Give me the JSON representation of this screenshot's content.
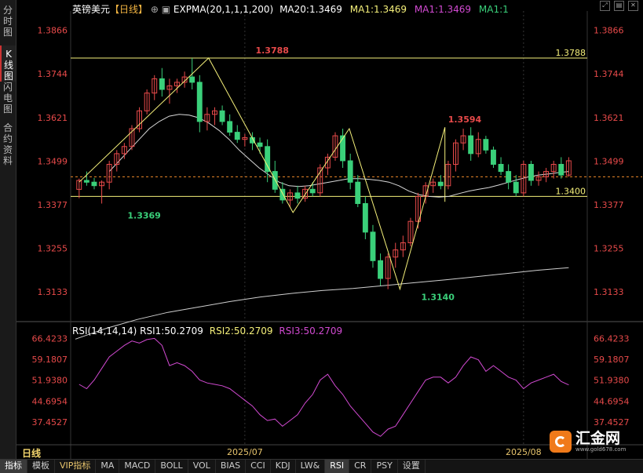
{
  "sidebar": {
    "tabs": [
      {
        "label": "分时图",
        "active": false
      },
      {
        "label": "K线图",
        "active": true
      },
      {
        "label": "闪电图",
        "active": false
      },
      {
        "label": "合约资料",
        "active": false
      }
    ]
  },
  "header": {
    "symbol": "英镑美元",
    "period_tag": "【日线】",
    "indicator": "EXPMA(20,1,1,1,200)",
    "ma20": "MA20:1.3469",
    "ma1a": "MA1:1.3469",
    "ma1b": "MA1:1.3469",
    "ma1c": "MA1:1"
  },
  "rsi_header": {
    "name": "RSI(14,14,14)",
    "rsi1": "RSI1:50.2709",
    "rsi2": "RSI2:50.2709",
    "rsi3": "RSI3:50.2709"
  },
  "period_label": "日线",
  "bottom_tabs": [
    {
      "label": "指标",
      "active": true
    },
    {
      "label": "模板"
    },
    {
      "label": "VIP指标",
      "vip": true
    },
    {
      "label": "MA"
    },
    {
      "label": "MACD"
    },
    {
      "label": "BOLL"
    },
    {
      "label": "VOL"
    },
    {
      "label": "BIAS"
    },
    {
      "label": "CCI"
    },
    {
      "label": "KDJ"
    },
    {
      "label": "LW&"
    },
    {
      "label": "RSI",
      "active": true
    },
    {
      "label": "CR"
    },
    {
      "label": "PSY"
    },
    {
      "label": "设置"
    }
  ],
  "logo": {
    "name": "汇金网",
    "url": "www.gold678.com"
  },
  "colors": {
    "up": "#e84a4a",
    "down": "#3ad07a",
    "grid_text": "#e84a4a",
    "rsi": "#d24ad2",
    "ma": "#d8d8d8",
    "fib": "#f5f07a"
  },
  "chart_data": [
    {
      "type": "candlestick",
      "symbol": "英镑美元",
      "yticks": [
        "1.3866",
        "1.3744",
        "1.3621",
        "1.3499",
        "1.3377",
        "1.3255",
        "1.3133"
      ],
      "ylim": [
        1.306,
        1.392
      ],
      "xticks": [
        {
          "label": "2025/07",
          "index": 22
        },
        {
          "label": "2025/08",
          "index": 59
        }
      ],
      "hlines": [
        {
          "value": 1.3788,
          "label": "1.3788"
        },
        {
          "value": 1.34,
          "label": "1.3400"
        }
      ],
      "current_price": 1.3455,
      "annotations": [
        {
          "label": "1.3788",
          "index": 23,
          "value": 1.3788,
          "color": "#e84a4a"
        },
        {
          "label": "1.3369",
          "index": 6,
          "value": 1.3369,
          "color": "#3ad07a"
        },
        {
          "label": "1.3140",
          "index": 45,
          "value": 1.314,
          "color": "#3ad07a"
        },
        {
          "label": "1.3594",
          "index": 70,
          "value": 1.3594,
          "color": "#e84a4a"
        }
      ],
      "zigzag": [
        {
          "index": 0,
          "value": 1.344
        },
        {
          "index": 23,
          "value": 1.3788
        },
        {
          "index": 38,
          "value": 1.3355
        },
        {
          "index": 48,
          "value": 1.359
        },
        {
          "index": 57,
          "value": 1.314
        },
        {
          "index": 70,
          "value": 1.3594
        },
        {
          "index": 79,
          "value": 1.3385
        },
        {
          "index": 87,
          "value": 1.353
        }
      ],
      "candles": [
        [
          1.342,
          1.345,
          1.3395,
          1.3445
        ],
        [
          1.3445,
          1.347,
          1.343,
          1.344
        ],
        [
          1.344,
          1.3452,
          1.342,
          1.343
        ],
        [
          1.343,
          1.3445,
          1.338,
          1.344
        ],
        [
          1.344,
          1.35,
          1.342,
          1.349
        ],
        [
          1.349,
          1.353,
          1.347,
          1.352
        ],
        [
          1.352,
          1.355,
          1.3505,
          1.354
        ],
        [
          1.354,
          1.36,
          1.353,
          1.359
        ],
        [
          1.359,
          1.365,
          1.358,
          1.364
        ],
        [
          1.364,
          1.37,
          1.363,
          1.369
        ],
        [
          1.369,
          1.374,
          1.367,
          1.373
        ],
        [
          1.373,
          1.376,
          1.368,
          1.37
        ],
        [
          1.37,
          1.373,
          1.366,
          1.371
        ],
        [
          1.371,
          1.373,
          1.369,
          1.372
        ],
        [
          1.372,
          1.375,
          1.3705,
          1.3735
        ],
        [
          1.3735,
          1.3788,
          1.37,
          1.372
        ],
        [
          1.372,
          1.374,
          1.358,
          1.361
        ],
        [
          1.361,
          1.365,
          1.3585,
          1.363
        ],
        [
          1.363,
          1.365,
          1.36,
          1.364
        ],
        [
          1.364,
          1.3655,
          1.36,
          1.361
        ],
        [
          1.361,
          1.363,
          1.357,
          1.358
        ],
        [
          1.358,
          1.36,
          1.355,
          1.356
        ],
        [
          1.356,
          1.3575,
          1.354,
          1.3565
        ],
        [
          1.3565,
          1.358,
          1.353,
          1.355
        ],
        [
          1.355,
          1.3565,
          1.352,
          1.354
        ],
        [
          1.354,
          1.356,
          1.344,
          1.347
        ],
        [
          1.347,
          1.35,
          1.341,
          1.342
        ],
        [
          1.342,
          1.344,
          1.338,
          1.339
        ],
        [
          1.339,
          1.342,
          1.337,
          1.341
        ],
        [
          1.341,
          1.343,
          1.338,
          1.3395
        ],
        [
          1.3395,
          1.343,
          1.3385,
          1.342
        ],
        [
          1.342,
          1.344,
          1.34,
          1.341
        ],
        [
          1.341,
          1.349,
          1.34,
          1.348
        ],
        [
          1.348,
          1.352,
          1.346,
          1.351
        ],
        [
          1.351,
          1.358,
          1.35,
          1.357
        ],
        [
          1.357,
          1.359,
          1.348,
          1.35
        ],
        [
          1.35,
          1.352,
          1.342,
          1.344
        ],
        [
          1.344,
          1.346,
          1.337,
          1.338
        ],
        [
          1.338,
          1.34,
          1.328,
          1.33
        ],
        [
          1.33,
          1.332,
          1.32,
          1.322
        ],
        [
          1.322,
          1.324,
          1.315,
          1.317
        ],
        [
          1.317,
          1.324,
          1.314,
          1.323
        ],
        [
          1.323,
          1.327,
          1.32,
          1.325
        ],
        [
          1.325,
          1.329,
          1.323,
          1.327
        ],
        [
          1.327,
          1.334,
          1.326,
          1.333
        ],
        [
          1.333,
          1.341,
          1.331,
          1.34
        ],
        [
          1.34,
          1.344,
          1.338,
          1.343
        ],
        [
          1.343,
          1.345,
          1.341,
          1.344
        ],
        [
          1.344,
          1.346,
          1.342,
          1.343
        ],
        [
          1.343,
          1.35,
          1.342,
          1.349
        ],
        [
          1.349,
          1.356,
          1.347,
          1.355
        ],
        [
          1.355,
          1.359,
          1.353,
          1.357
        ],
        [
          1.357,
          1.3594,
          1.35,
          1.352
        ],
        [
          1.352,
          1.358,
          1.351,
          1.356
        ],
        [
          1.356,
          1.357,
          1.352,
          1.353
        ],
        [
          1.353,
          1.354,
          1.348,
          1.349
        ],
        [
          1.349,
          1.351,
          1.346,
          1.347
        ],
        [
          1.347,
          1.349,
          1.342,
          1.344
        ],
        [
          1.344,
          1.346,
          1.34,
          1.341
        ],
        [
          1.341,
          1.35,
          1.34,
          1.349
        ],
        [
          1.349,
          1.35,
          1.343,
          1.3445
        ],
        [
          1.3445,
          1.347,
          1.343,
          1.3455
        ],
        [
          1.3455,
          1.348,
          1.344,
          1.347
        ],
        [
          1.347,
          1.35,
          1.345,
          1.349
        ],
        [
          1.349,
          1.351,
          1.345,
          1.346
        ],
        [
          1.346,
          1.351,
          1.3455,
          1.35
        ]
      ],
      "ma_slow": [
        1.347,
        1.35,
        1.353,
        1.356,
        1.359,
        1.361,
        1.3625,
        1.363,
        1.3628,
        1.362,
        1.3605,
        1.3585,
        1.356,
        1.353,
        1.3505,
        1.348,
        1.346,
        1.344,
        1.343,
        1.3428,
        1.343,
        1.3435,
        1.344,
        1.3445,
        1.345,
        1.345,
        1.3448,
        1.3445,
        1.344,
        1.343,
        1.3415,
        1.3405,
        1.34,
        1.3398,
        1.34,
        1.3408,
        1.3415,
        1.342,
        1.3425,
        1.3432,
        1.344,
        1.3448,
        1.3455,
        1.346,
        1.3463,
        1.3467,
        1.347
      ],
      "ma_200": [
        1.3,
        1.303,
        1.3055,
        1.3075,
        1.309,
        1.3105,
        1.3118,
        1.3128,
        1.3136,
        1.3142,
        1.315,
        1.3158,
        1.3166,
        1.3175,
        1.3184,
        1.3193,
        1.32
      ]
    },
    {
      "type": "line",
      "name": "RSI(14,14,14)",
      "yticks": [
        "66.4233",
        "59.1807",
        "51.9380",
        "44.6954",
        "37.4527"
      ],
      "ylim": [
        31.5,
        69.5
      ],
      "values": [
        50.5,
        49,
        52,
        56,
        60,
        62,
        64,
        65.5,
        64.8,
        66,
        66.4,
        64,
        57,
        58,
        57,
        55,
        52,
        51,
        50.5,
        50,
        49,
        47,
        45,
        43,
        40,
        38,
        38.5,
        36,
        38,
        40,
        44,
        47,
        52,
        54,
        50,
        47,
        43,
        40,
        37,
        34,
        32.5,
        35,
        36,
        40,
        44,
        48,
        52,
        53,
        53,
        51,
        53,
        57,
        60,
        59,
        55,
        57,
        55,
        53,
        52,
        49,
        51,
        52,
        53,
        54,
        51.5,
        50.3
      ]
    }
  ]
}
